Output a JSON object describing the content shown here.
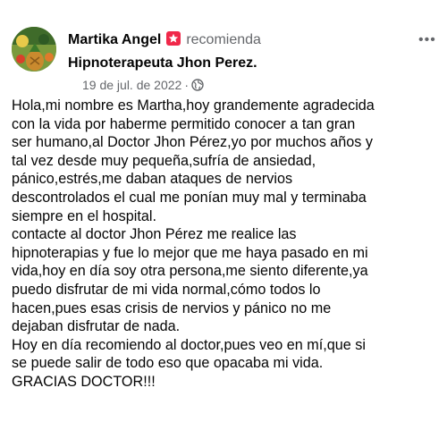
{
  "post": {
    "author": "Martika Angel",
    "action": "recomienda",
    "page": "Hipnoterapeuta Jhon Perez",
    "page_suffix": ".",
    "date": "19 de jul. de 2022",
    "separator": "·",
    "more_label": "•••",
    "icons": {
      "avatar": "avatar-photo",
      "recommend": "recommend-icon",
      "privacy": "globe-icon",
      "more": "more-options-icon"
    },
    "colors": {
      "recommend_badge": "#f02849",
      "secondary_text": "#65676b",
      "primary_text": "#050505"
    },
    "body_lines": [
      "Hola,mi nombre es Martha,hoy grandemente agradecida",
      "con la vida por haberme permitido conocer a tan gran",
      "ser humano,al Doctor Jhon Pérez,yo por muchos años y",
      "tal vez desde muy pequeña,sufría de ansiedad,",
      "pánico,estrés,me daban ataques de nervios",
      "descontrolados el cual me ponían muy mal y terminaba",
      "siempre en el hospital.",
      "contacte al doctor Jhon Pérez me realice las",
      "hipnoterapias y fue lo mejor que me haya pasado en mi",
      "vida,hoy en día soy otra persona,me siento diferente,ya",
      "puedo disfrutar de mi vida normal,cómo todos lo",
      "hacen,pues esas crisis de nervios y pánico no me",
      "dejaban disfrutar de nada.",
      "Hoy en día recomiendo al doctor,pues veo en mí,que si",
      "se puede salir de todo eso que opacaba mi vida.",
      "GRACIAS DOCTOR!!!"
    ]
  }
}
